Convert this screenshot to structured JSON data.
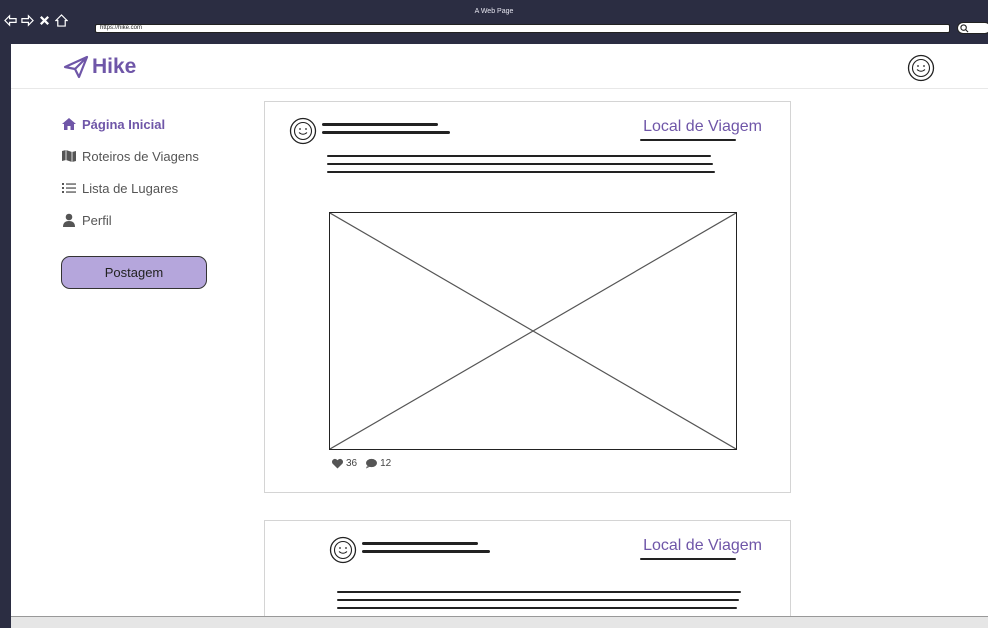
{
  "window": {
    "title": "A Web Page",
    "url": "https://hike.com"
  },
  "app": {
    "name": "Hike",
    "accent": "#6f56a8"
  },
  "sidebar": {
    "items": [
      {
        "label": "Página Inicial",
        "icon": "home-icon",
        "active": true
      },
      {
        "label": "Roteiros de Viagens",
        "icon": "map-icon",
        "active": false
      },
      {
        "label": "Lista de Lugares",
        "icon": "list-icon",
        "active": false
      },
      {
        "label": "Perfil",
        "icon": "user-icon",
        "active": false
      }
    ],
    "post_button": "Postagem"
  },
  "posts": [
    {
      "location_title": "Local de Viagem",
      "likes": "36",
      "comments": "12"
    },
    {
      "location_title": "Local de Viagem"
    }
  ]
}
